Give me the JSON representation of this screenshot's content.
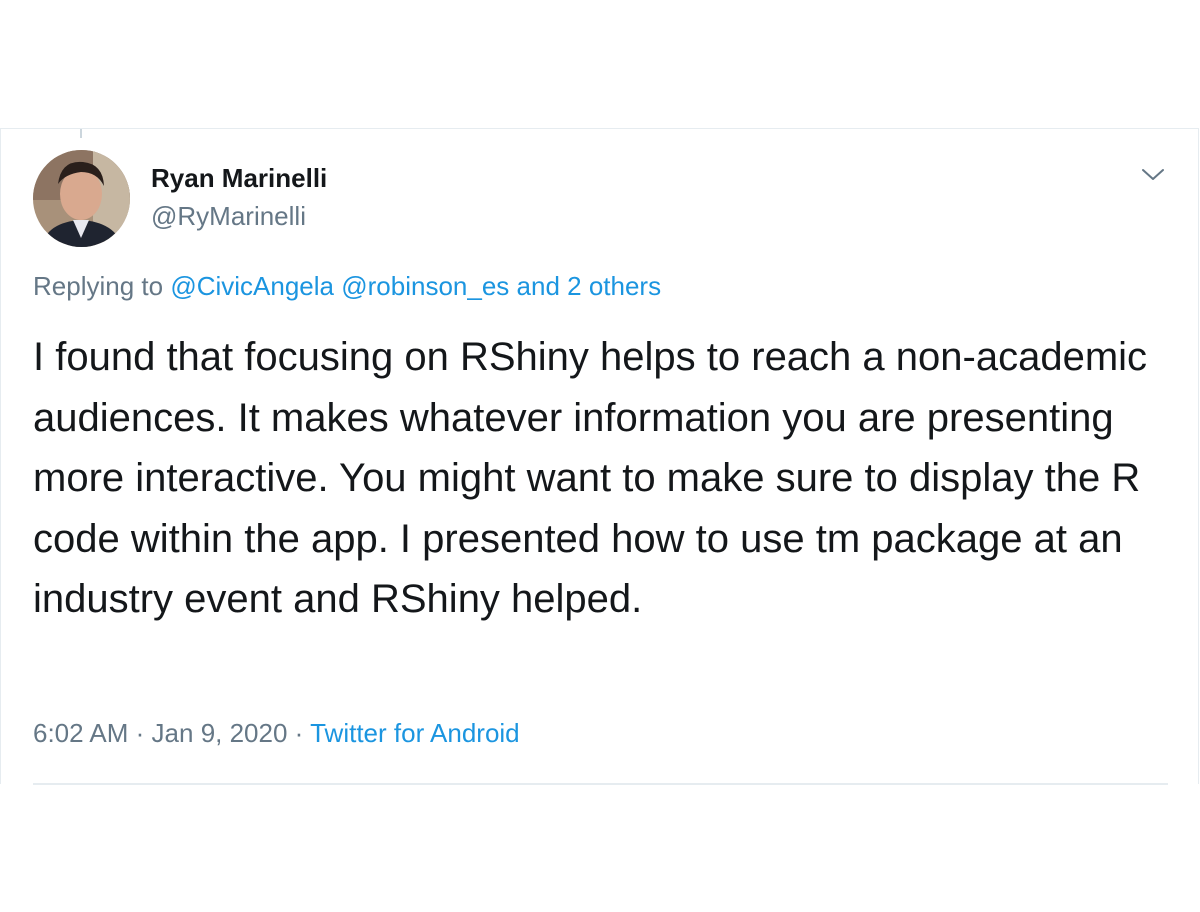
{
  "tweet": {
    "author_name": "Ryan Marinelli",
    "author_handle": "@RyMarinelli",
    "avatar_icon": "user-avatar-photo",
    "menu_icon": "chevron-down-icon",
    "replying": {
      "prefix": "Replying to ",
      "mention_1": "@CivicAngela",
      "mention_2": "@robinson_es",
      "others": "and 2 others"
    },
    "text": "I found that focusing on RShiny helps to reach a non-academic audiences. It makes whatever information you are presenting more interactive. You might want to make sure to display the R code within the app. I presented how to use tm package at an industry event and RShiny helped.",
    "time": "6:02 AM",
    "separator": "·",
    "date": "Jan 9, 2020",
    "source": "Twitter for Android"
  },
  "colors": {
    "link": "#1b95e0",
    "secondary_text": "#657786",
    "primary_text": "#14171a",
    "border": "#e6ecf0"
  }
}
